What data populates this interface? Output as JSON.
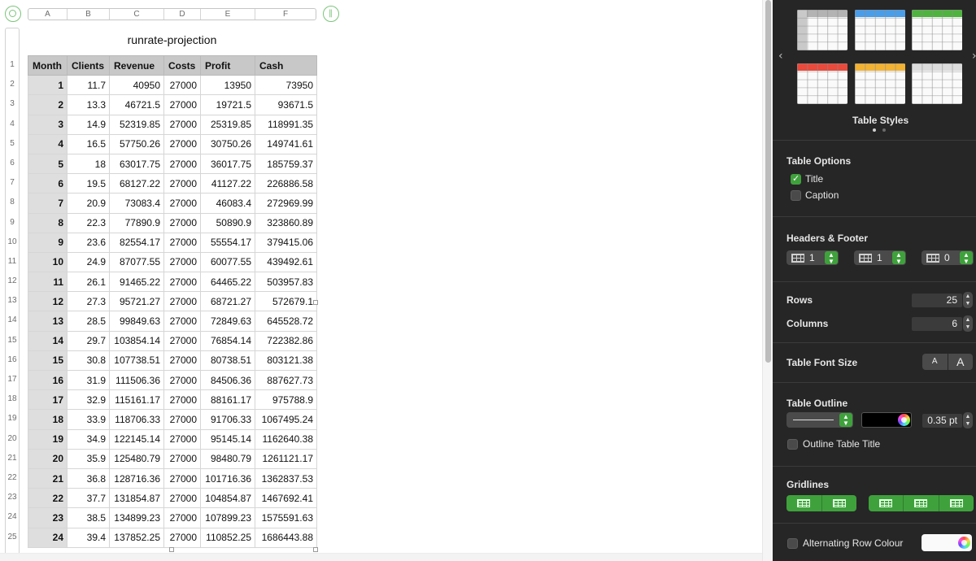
{
  "spreadsheet": {
    "column_letters": [
      "A",
      "B",
      "C",
      "D",
      "E",
      "F"
    ],
    "row_numbers": [
      "1",
      "2",
      "3",
      "4",
      "5",
      "6",
      "7",
      "8",
      "9",
      "10",
      "11",
      "12",
      "13",
      "14",
      "15",
      "16",
      "17",
      "18",
      "19",
      "20",
      "21",
      "22",
      "23",
      "24",
      "25"
    ],
    "table_title": "runrate-projection",
    "headers": [
      "Month",
      "Clients",
      "Revenue",
      "Costs",
      "Profit",
      "Cash"
    ],
    "rows": [
      [
        "1",
        "11.7",
        "40950",
        "27000",
        "13950",
        "73950"
      ],
      [
        "2",
        "13.3",
        "46721.5",
        "27000",
        "19721.5",
        "93671.5"
      ],
      [
        "3",
        "14.9",
        "52319.85",
        "27000",
        "25319.85",
        "118991.35"
      ],
      [
        "4",
        "16.5",
        "57750.26",
        "27000",
        "30750.26",
        "149741.61"
      ],
      [
        "5",
        "18",
        "63017.75",
        "27000",
        "36017.75",
        "185759.37"
      ],
      [
        "6",
        "19.5",
        "68127.22",
        "27000",
        "41127.22",
        "226886.58"
      ],
      [
        "7",
        "20.9",
        "73083.4",
        "27000",
        "46083.4",
        "272969.99"
      ],
      [
        "8",
        "22.3",
        "77890.9",
        "27000",
        "50890.9",
        "323860.89"
      ],
      [
        "9",
        "23.6",
        "82554.17",
        "27000",
        "55554.17",
        "379415.06"
      ],
      [
        "10",
        "24.9",
        "87077.55",
        "27000",
        "60077.55",
        "439492.61"
      ],
      [
        "11",
        "26.1",
        "91465.22",
        "27000",
        "64465.22",
        "503957.83"
      ],
      [
        "12",
        "27.3",
        "95721.27",
        "27000",
        "68721.27",
        "572679.1"
      ],
      [
        "13",
        "28.5",
        "99849.63",
        "27000",
        "72849.63",
        "645528.72"
      ],
      [
        "14",
        "29.7",
        "103854.14",
        "27000",
        "76854.14",
        "722382.86"
      ],
      [
        "15",
        "30.8",
        "107738.51",
        "27000",
        "80738.51",
        "803121.38"
      ],
      [
        "16",
        "31.9",
        "111506.36",
        "27000",
        "84506.36",
        "887627.73"
      ],
      [
        "17",
        "32.9",
        "115161.17",
        "27000",
        "88161.17",
        "975788.9"
      ],
      [
        "18",
        "33.9",
        "118706.33",
        "27000",
        "91706.33",
        "1067495.24"
      ],
      [
        "19",
        "34.9",
        "122145.14",
        "27000",
        "95145.14",
        "1162640.38"
      ],
      [
        "20",
        "35.9",
        "125480.79",
        "27000",
        "98480.79",
        "1261121.17"
      ],
      [
        "21",
        "36.8",
        "128716.36",
        "27000",
        "101716.36",
        "1362837.53"
      ],
      [
        "22",
        "37.7",
        "131854.87",
        "27000",
        "104854.87",
        "1467692.41"
      ],
      [
        "23",
        "38.5",
        "134899.23",
        "27000",
        "107899.23",
        "1575591.63"
      ],
      [
        "24",
        "39.4",
        "137852.25",
        "27000",
        "110852.25",
        "1686443.88"
      ]
    ]
  },
  "inspector": {
    "table_styles": {
      "label": "Table Styles",
      "header_colors": [
        "#b3b3b3",
        "#4a9de8",
        "#4fb43f",
        "#e84a3c",
        "#f2b233",
        "#dcdcdc"
      ]
    },
    "table_options": {
      "label": "Table Options",
      "title_label": "Title",
      "title_checked": true,
      "caption_label": "Caption",
      "caption_checked": false
    },
    "headers_footer": {
      "label": "Headers & Footer",
      "header_rows": "1",
      "header_columns": "1",
      "footer_rows": "0"
    },
    "rows": {
      "label": "Rows",
      "value": "25"
    },
    "columns": {
      "label": "Columns",
      "value": "6"
    },
    "font_size": {
      "label": "Table Font Size",
      "smaller": "A",
      "bigger": "A"
    },
    "outline": {
      "label": "Table Outline",
      "stroke_color": "#000000",
      "width": "0.35 pt",
      "outline_title_label": "Outline Table Title"
    },
    "gridlines": {
      "label": "Gridlines"
    },
    "alternating": {
      "label": "Alternating Row Colour",
      "color": "#fafafa"
    },
    "accent": "#3fa13c"
  }
}
